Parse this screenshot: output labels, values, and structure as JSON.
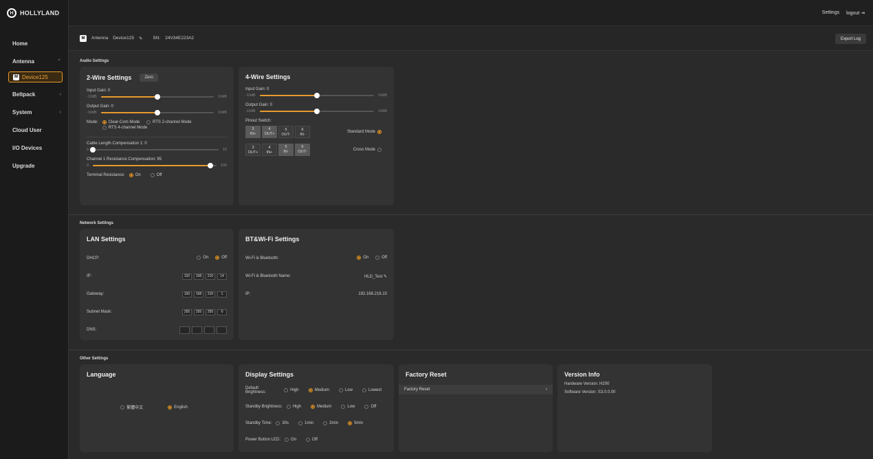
{
  "brand": {
    "logo_text": "HOLLYLAND",
    "accent": "#e89a2d"
  },
  "sidebar": {
    "items": [
      {
        "label": "Home"
      },
      {
        "label": "Antenna"
      },
      {
        "label": "Beltpack"
      },
      {
        "label": "System"
      },
      {
        "label": "Cloud User"
      },
      {
        "label": "I/O Devices"
      },
      {
        "label": "Upgrade"
      }
    ],
    "active_sub": {
      "badge": "M",
      "label": "Device125"
    }
  },
  "topbar": {
    "settings": "Settings",
    "logout": "logout"
  },
  "device": {
    "badge": "M",
    "type": "Antenna",
    "name": "Device125",
    "sn_label": "SN:",
    "sn": "24V34E223A2",
    "export_label": "Export Log"
  },
  "audio": {
    "section": "Audio Settings",
    "two_wire": {
      "title": "2-Wire Settings",
      "zero": "Zero",
      "input_gain": "Input Gain: 0",
      "input_min": "-10dB",
      "input_max": "10dB",
      "input_level": 0.5,
      "output_gain": "Output Gain: 0",
      "output_min": "-10dB",
      "output_max": "10dB",
      "output_level": 0.5,
      "mode_label": "Mode:",
      "modes": [
        "Clear-Com Mode",
        "RTS 2-channel Mode",
        "RTS 4-channel Mode"
      ],
      "mode_selected": 0,
      "cable_label": "Cable Length Compensation 1:  0",
      "cable_min": "0",
      "cable_max": "15",
      "cable_level": 0.0,
      "resist_label": "Channel 1 Resistance Compensation:  95",
      "resist_min": "0",
      "resist_max": "100",
      "resist_level": 0.95,
      "terminal_label": "Terminal Resistance:",
      "on": "On",
      "off": "Off"
    },
    "four_wire": {
      "title": "4-Wire Settings",
      "input_gain": "Input Gain: 0",
      "input_min": "-10dB",
      "input_max": "10dB",
      "input_level": 0.5,
      "output_gain": "Output Gain: 0",
      "output_min": "-10dB",
      "output_max": "10dB",
      "output_level": 0.5,
      "pinout_label": "Pinout Switch:",
      "standard": {
        "label": "Standard Mode",
        "pins": [
          [
            "3",
            "IN+"
          ],
          [
            "4",
            "OUT+"
          ],
          [
            "5",
            "OUT-"
          ],
          [
            "6",
            "IN-"
          ]
        ]
      },
      "cross": {
        "label": "Cross Mode",
        "pins": [
          [
            "3",
            "OUT+"
          ],
          [
            "4",
            "IN+"
          ],
          [
            "5",
            "IN-"
          ],
          [
            "6",
            "OUT-"
          ]
        ]
      }
    }
  },
  "network": {
    "section": "Network Settings",
    "lan": {
      "title": "LAN Settings",
      "dhcp_label": "DHCP:",
      "on": "On",
      "off": "Off",
      "ip_label": "IP:",
      "ip": [
        "192",
        "168",
        "210",
        "14"
      ],
      "gw_label": "Gateway:",
      "gw": [
        "192",
        "168",
        "210",
        "1"
      ],
      "mask_label": "Subnet Mask:",
      "mask": [
        "255",
        "255",
        "255",
        "0"
      ],
      "dns_label": "DNS:"
    },
    "bt": {
      "title": "BT&Wi-Fi Settings",
      "wifi_label": "Wi-Fi & Bluetooth:",
      "on": "On",
      "off": "Off",
      "name_label": "Wi-Fi & Bluetooth Name:",
      "name": "HLD_Test",
      "ip_label": "IP:",
      "ip": "192.168.216.10"
    }
  },
  "other": {
    "section": "Other Settings",
    "language": {
      "title": "Language",
      "options": [
        "繁體中文",
        "English"
      ]
    },
    "display": {
      "title": "Display Settings",
      "default_label": "Default Brightness:",
      "default_opts": [
        "High",
        "Medium",
        "Low",
        "Lowest"
      ],
      "standby_label": "Standby Brightness:",
      "standby_opts": [
        "High",
        "Medium",
        "Low",
        "Off"
      ],
      "time_label": "Standby Time:",
      "time_opts": [
        "30s",
        "1min",
        "2min",
        "5min"
      ],
      "led_label": "Power Button LED:",
      "led_opts": [
        "On",
        "Off"
      ]
    },
    "factory": {
      "title": "Factory Reset",
      "item": "Factory Reset"
    },
    "version": {
      "title": "Version Info",
      "hw": "Hardware Version:  H200",
      "sw": "Software Version:  S3.0.0.00"
    }
  }
}
